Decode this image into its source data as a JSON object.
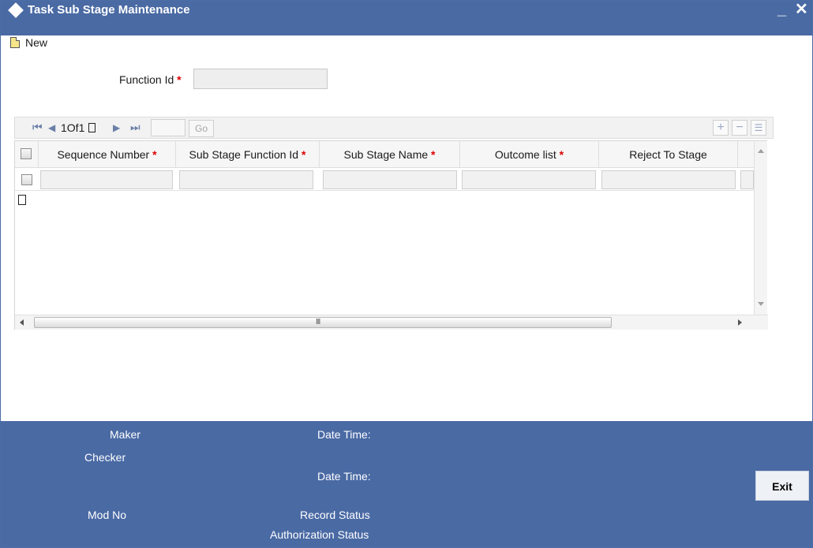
{
  "window": {
    "title": "Task Sub Stage Maintenance",
    "minimize_glyph": "_",
    "close_glyph": "✕"
  },
  "toolbar": {
    "new_label": "New"
  },
  "form": {
    "function_id_label": "Function Id",
    "required_mark": "*",
    "function_id_value": ""
  },
  "pager": {
    "first": "⏮",
    "prev": "◀",
    "page_text": "1Of1",
    "next": "▶",
    "last": "⏭",
    "go_label": "Go"
  },
  "grid": {
    "columns": [
      {
        "label": "Sequence Number",
        "required": true
      },
      {
        "label": "Sub Stage Function Id",
        "required": true
      },
      {
        "label": "Sub Stage Name",
        "required": true
      },
      {
        "label": "Outcome list",
        "required": true
      },
      {
        "label": "Reject To Stage",
        "required": false
      }
    ],
    "row_buttons": {
      "add": "+",
      "delete": "−",
      "view": "☰"
    },
    "scroll_grip": "III"
  },
  "footer": {
    "maker": "Maker",
    "checker": "Checker",
    "date_time_1": "Date Time:",
    "date_time_2": "Date Time:",
    "mod_no": "Mod No",
    "record_status": "Record Status",
    "authorization_status": "Authorization Status",
    "exit_label": "Exit"
  },
  "colors": {
    "titlebar": "#4a6aa4",
    "footer": "#4a6aa4",
    "required": "#dd0000"
  }
}
